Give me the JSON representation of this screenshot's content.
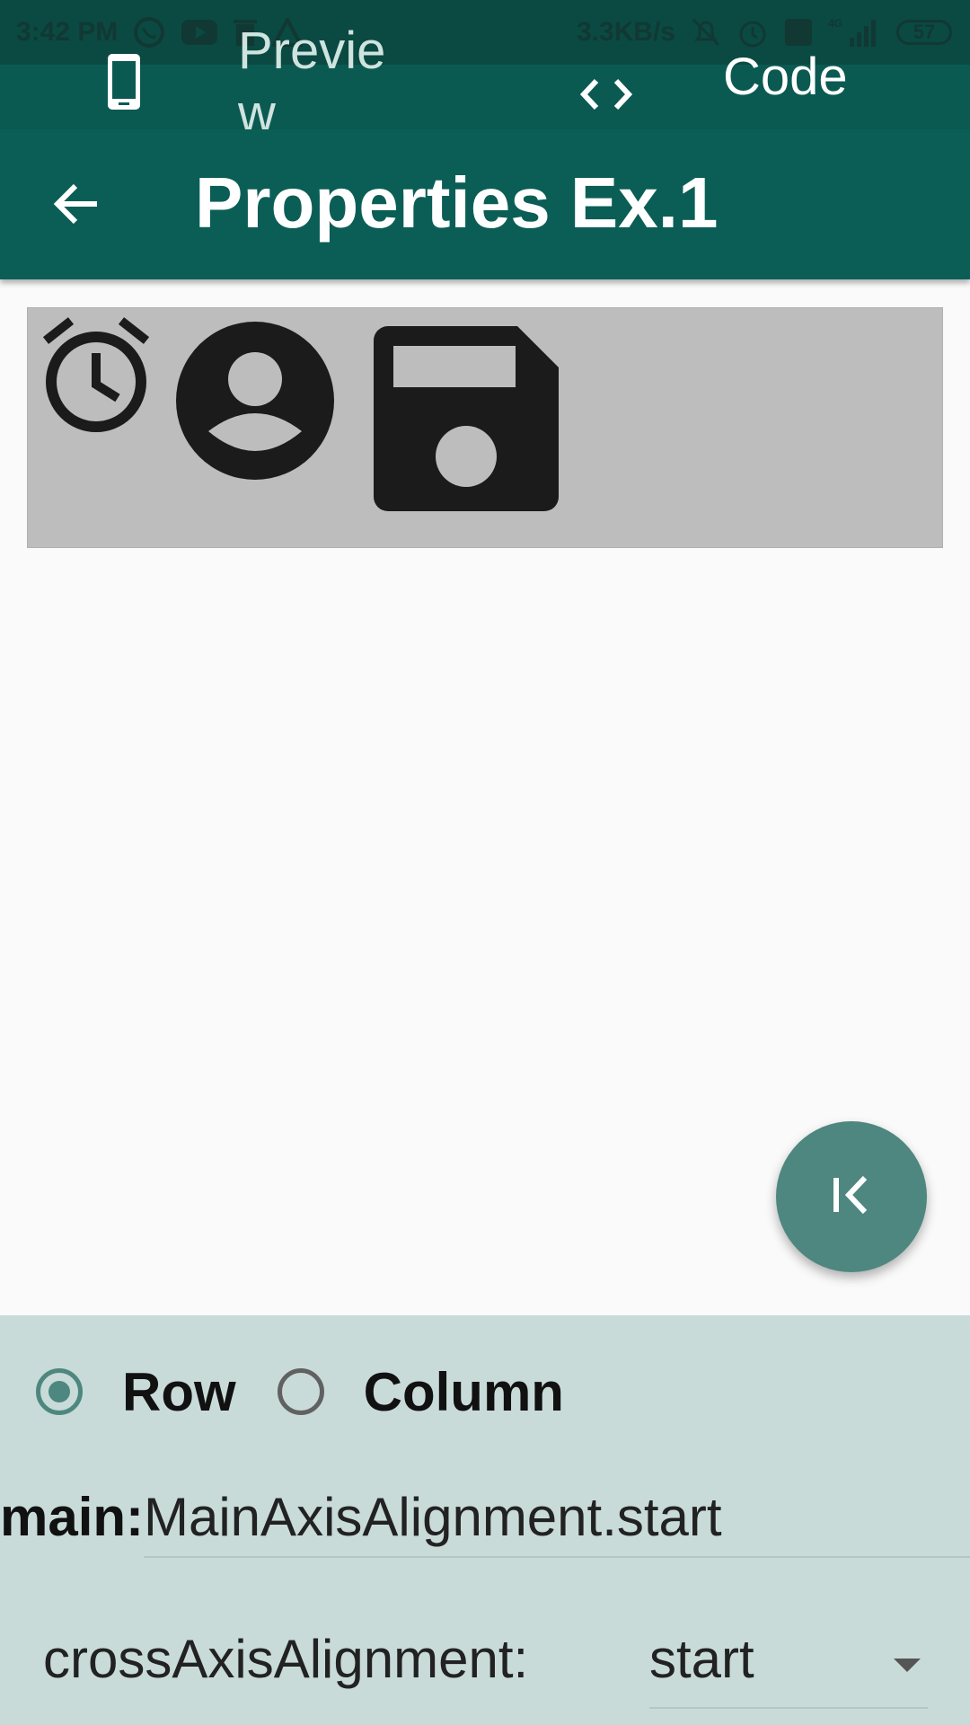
{
  "status_bar": {
    "time": "3:42 PM",
    "network_speed": "3.3KB/s",
    "network_type": "4G",
    "battery": "57",
    "left_icons": [
      "whatsapp-icon",
      "youtube-icon",
      "trash-icon",
      "warning-icon"
    ],
    "right_icons": [
      "mute-icon",
      "alarm-icon",
      "volte-icon",
      "signal-icon",
      "battery-icon"
    ]
  },
  "tabs": [
    {
      "label": "Preview",
      "icon": "phone-icon",
      "selected": false
    },
    {
      "label": "Code",
      "icon": "code-icon",
      "selected": true
    }
  ],
  "app_bar": {
    "title": "Properties Ex.1",
    "back_icon": "arrow-back-icon"
  },
  "preview": {
    "icons": [
      "alarm-icon",
      "account-circle-icon",
      "save-icon"
    ],
    "background": "#bdbdbd"
  },
  "fab": {
    "icon": "first-page-icon",
    "color": "#4e877f"
  },
  "controls": {
    "direction_options": [
      {
        "label": "Row",
        "selected": true
      },
      {
        "label": "Column",
        "selected": false
      }
    ],
    "main_label": "main:",
    "main_value": "MainAxisAlignment.start",
    "cross_label": "crossAxisAlignment:",
    "cross_value": "start"
  },
  "colors": {
    "primary": "#0b5e55",
    "primary_dark": "#0a4a43",
    "accent": "#4e877f",
    "panel": "#c8dbd9"
  }
}
